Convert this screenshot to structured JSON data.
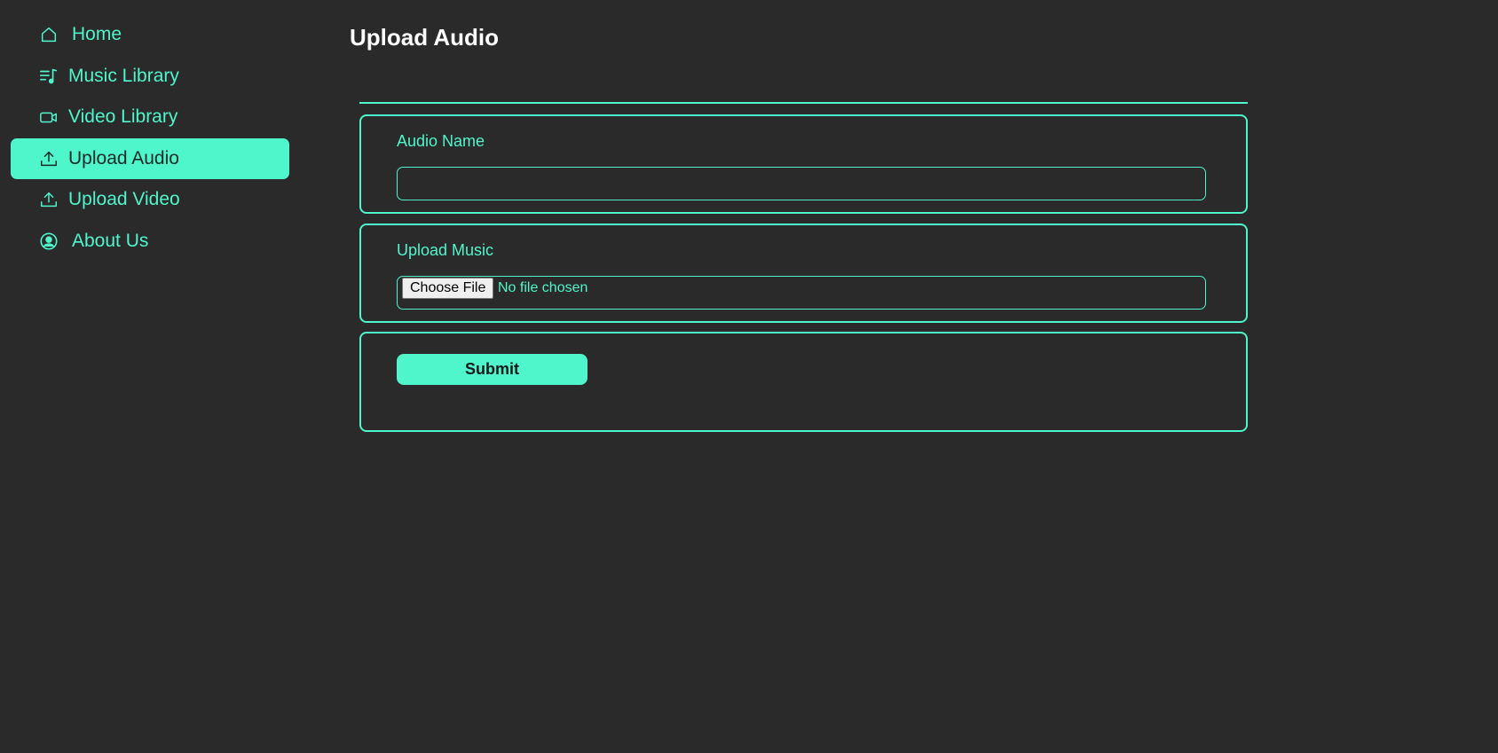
{
  "sidebar": {
    "items": [
      {
        "label": "Home",
        "icon": "home-icon",
        "active": false
      },
      {
        "label": "Music Library",
        "icon": "music-list-icon",
        "active": false
      },
      {
        "label": "Video Library",
        "icon": "video-camera-icon",
        "active": false
      },
      {
        "label": "Upload Audio",
        "icon": "upload-icon",
        "active": true
      },
      {
        "label": "Upload Video",
        "icon": "upload-icon",
        "active": false
      },
      {
        "label": "About Us",
        "icon": "user-circle-icon",
        "active": false
      }
    ]
  },
  "main": {
    "title": "Upload Audio",
    "form": {
      "audio_name_label": "Audio Name",
      "audio_name_value": "",
      "upload_music_label": "Upload Music",
      "choose_file_label": "Choose File",
      "file_status": "No file chosen",
      "submit_label": "Submit"
    }
  },
  "colors": {
    "accent": "#4ff5cb",
    "background": "#2a2a2a",
    "title": "#ffffff"
  }
}
